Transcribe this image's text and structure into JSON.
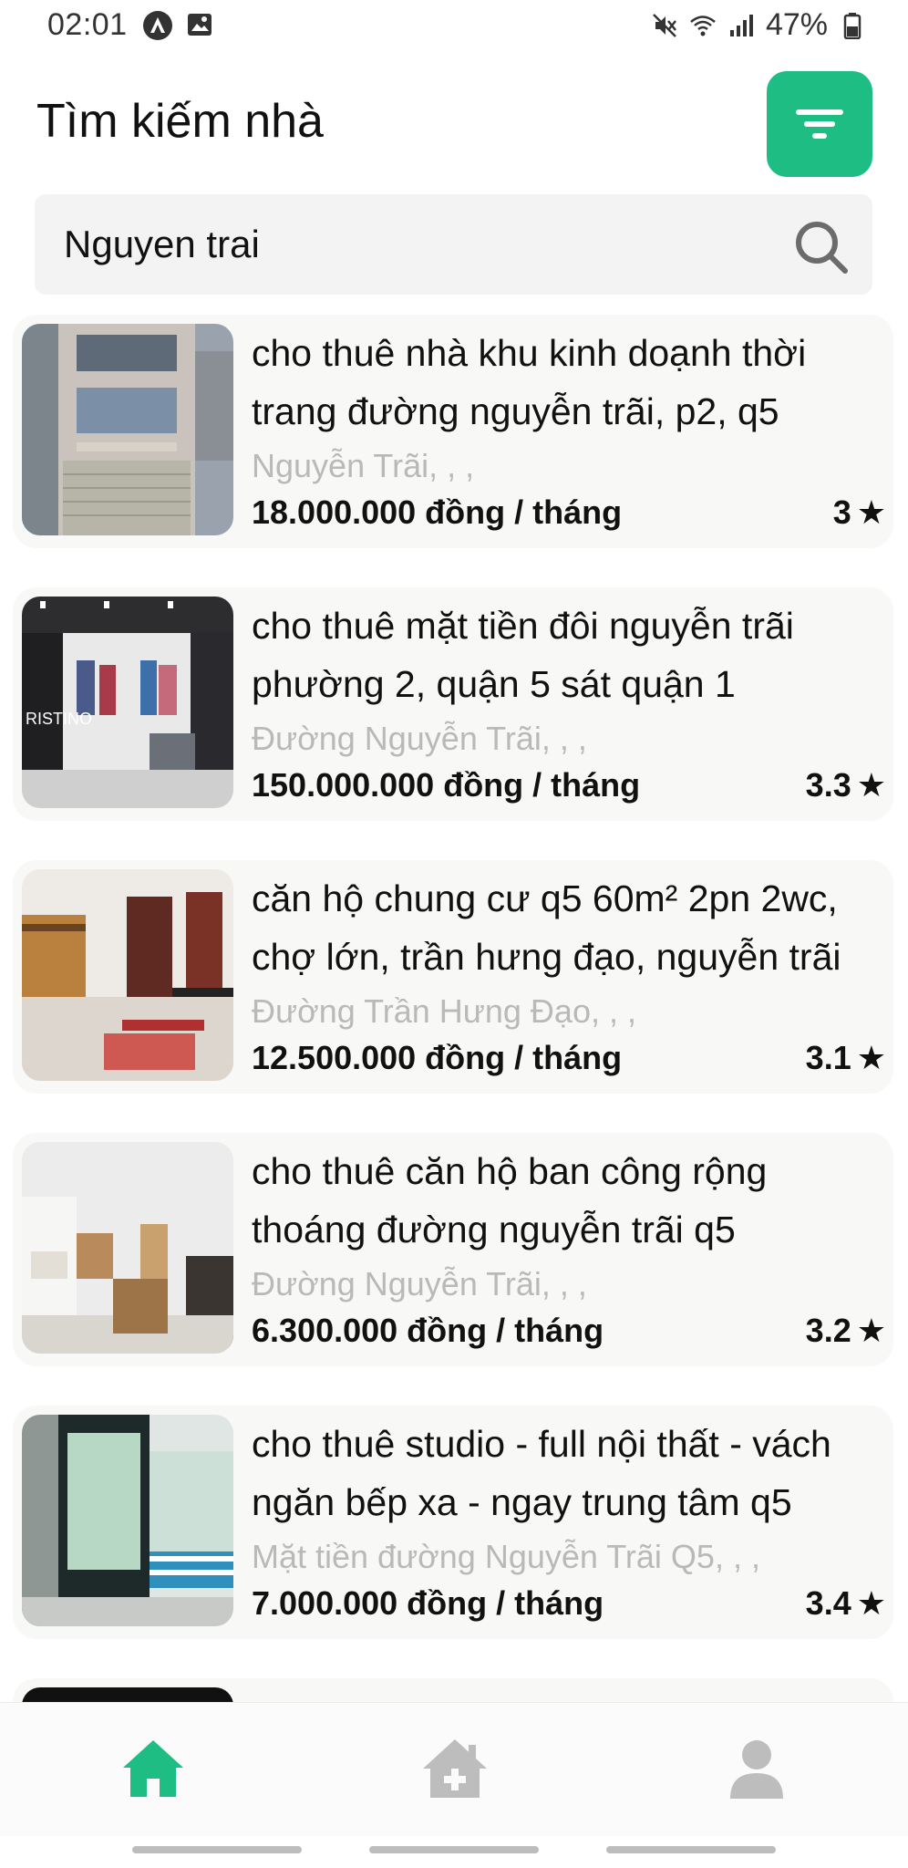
{
  "status_bar": {
    "time": "02:01",
    "battery": "47%"
  },
  "header": {
    "title": "Tìm kiếm nhà"
  },
  "search": {
    "value": "Nguyen trai"
  },
  "colors": {
    "accent": "#1ebd84",
    "inactive_nav": "#bdbdbd",
    "address_text": "#b9b9b9"
  },
  "listings": [
    {
      "title": "cho thuê nhà khu kinh doạnh thời trang đường nguyễn trãi, p2, q5",
      "address": "Nguyễn Trãi, , ,",
      "price": "18.000.000 đồng / tháng",
      "rating": "3"
    },
    {
      "title": "cho thuê mặt tiền đôi nguyễn trãi phường 2, quận 5 sát quận 1",
      "address": "Đường Nguyễn Trãi, , ,",
      "price": "150.000.000 đồng / tháng",
      "rating": "3.3"
    },
    {
      "title": "căn hộ chung cư q5 60m² 2pn 2wc, chợ lớn, trần hưng đạo, nguyễn trãi",
      "address": "Đường Trần Hưng Đạo, , ,",
      "price": "12.500.000 đồng / tháng",
      "rating": "3.1"
    },
    {
      "title": "cho thuê căn hộ ban công rộng thoáng đường nguyễn trãi q5",
      "address": "Đường Nguyễn Trãi, , ,",
      "price": "6.300.000 đồng / tháng",
      "rating": "3.2"
    },
    {
      "title": "cho thuê studio - full nội thất - vách ngăn bếp xa - ngay trung tâm q5",
      "address": "Mặt tiền đường Nguyễn Trãi Q5, , ,",
      "price": "7.000.000 đồng / tháng",
      "rating": "3.4"
    }
  ],
  "bottom_nav": [
    {
      "icon": "home-icon",
      "active": true
    },
    {
      "icon": "add-house-icon",
      "active": false
    },
    {
      "icon": "user-icon",
      "active": false
    }
  ]
}
